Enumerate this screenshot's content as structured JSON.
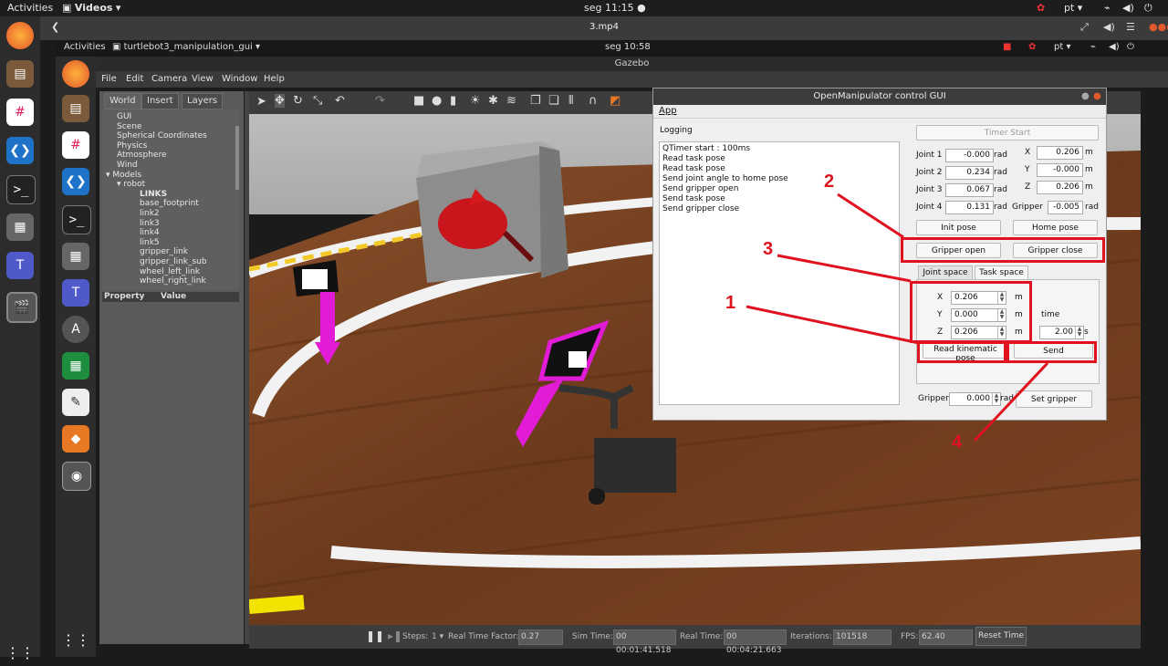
{
  "outer_topbar": {
    "activities": "Activities",
    "app": "Videos",
    "clock": "seg 11:15",
    "lang": "pt"
  },
  "video": {
    "title": "3.mp4"
  },
  "inner_topbar": {
    "activities": "Activities",
    "app": "turtlebot3_manipulation_gui",
    "clock": "seg 10:58",
    "lang": "pt"
  },
  "gazebo": {
    "title": "Gazebo",
    "menu": [
      "File",
      "Edit",
      "Camera",
      "View",
      "Window",
      "Help"
    ],
    "tabs": [
      "World",
      "Insert",
      "Layers"
    ],
    "tree": [
      "GUI",
      "Scene",
      "Spherical Coordinates",
      "Physics",
      "Atmosphere",
      "Wind",
      "Models",
      "robot",
      "LINKS",
      "base_footprint",
      "link2",
      "link3",
      "link4",
      "link5",
      "gripper_link",
      "gripper_link_sub",
      "wheel_left_link",
      "wheel_right_link"
    ],
    "property_header": "Property",
    "value_header": "Value",
    "bottom": {
      "steps_label": "Steps:",
      "steps_value": "1",
      "rtf_label": "Real Time Factor:",
      "rtf_value": "0.27",
      "sim_label": "Sim Time:",
      "sim_value": "00 00:01:41.518",
      "real_label": "Real Time:",
      "real_value": "00 00:04:21.663",
      "iter_label": "Iterations:",
      "iter_value": "101518",
      "fps_label": "FPS:",
      "fps_value": "62.40",
      "reset": "Reset Time"
    }
  },
  "om_gui": {
    "title": "OpenManipulator control GUI",
    "menu": "App",
    "logging_label": "Logging",
    "log_lines": [
      "QTimer start : 100ms",
      "Read task pose",
      "Read task pose",
      "Send joint angle to home pose",
      "Send gripper open",
      "Send task pose",
      "Send gripper close"
    ],
    "timer_start": "Timer Start",
    "joints": [
      {
        "label": "Joint 1",
        "value": "-0.000",
        "unit": "rad"
      },
      {
        "label": "Joint 2",
        "value": "0.234",
        "unit": "rad"
      },
      {
        "label": "Joint 3",
        "value": "0.067",
        "unit": "rad"
      },
      {
        "label": "Joint 4",
        "value": "0.131",
        "unit": "rad"
      }
    ],
    "pose": [
      {
        "label": "X",
        "value": "0.206",
        "unit": "m"
      },
      {
        "label": "Y",
        "value": "-0.000",
        "unit": "m"
      },
      {
        "label": "Z",
        "value": "0.206",
        "unit": "m"
      }
    ],
    "gripper_label": "Gripper",
    "gripper_value": "-0.005",
    "gripper_unit": "rad",
    "init_pose": "Init pose",
    "home_pose": "Home pose",
    "gripper_open": "Gripper open",
    "gripper_close": "Gripper close",
    "tab_joint": "Joint space",
    "tab_task": "Task space",
    "task": [
      {
        "label": "X",
        "value": "0.206",
        "unit": "m"
      },
      {
        "label": "Y",
        "value": "0.000",
        "unit": "m"
      },
      {
        "label": "Z",
        "value": "0.206",
        "unit": "m"
      }
    ],
    "time_label": "time",
    "time_value": "2.00",
    "time_unit": "s",
    "read_kinematic": "Read kinematic pose",
    "send": "Send",
    "gripper_bottom_label": "Gripper",
    "gripper_bottom_value": "0.000",
    "gripper_bottom_unit": "rad",
    "set_gripper": "Set gripper"
  },
  "annotations": {
    "n1": "1",
    "n2": "2",
    "n3": "3",
    "n4": "4"
  }
}
